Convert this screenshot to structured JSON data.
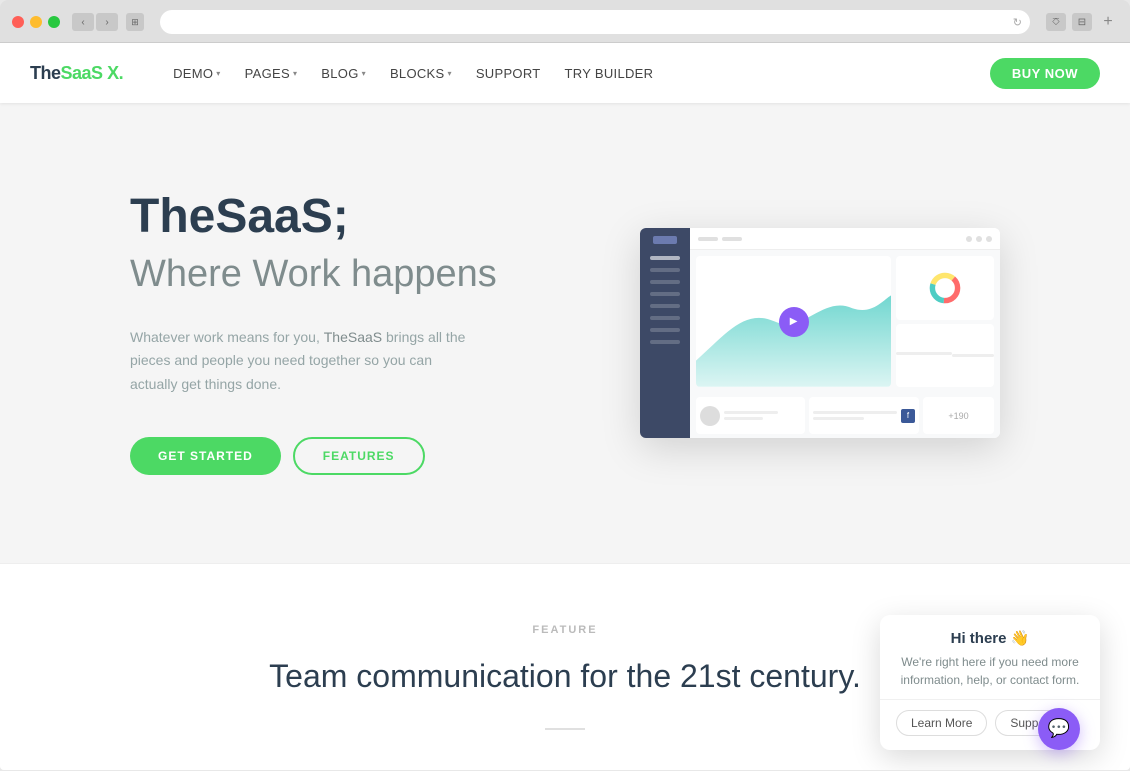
{
  "browser": {
    "traffic_lights": [
      "red",
      "yellow",
      "green"
    ],
    "back_label": "‹",
    "forward_label": "›",
    "tab_label": "⊞",
    "refresh_label": "↻",
    "share_label": "⎏",
    "new_tab_label": "+"
  },
  "navbar": {
    "brand": "TheSaaS",
    "brand_suffix": " X.",
    "nav_items": [
      {
        "label": "DEMO",
        "has_arrow": true
      },
      {
        "label": "PAGES",
        "has_arrow": true
      },
      {
        "label": "BLOG",
        "has_arrow": true
      },
      {
        "label": "BLOCKS",
        "has_arrow": true
      },
      {
        "label": "SUPPORT",
        "has_arrow": false
      },
      {
        "label": "TRY BUILDER",
        "has_arrow": false
      }
    ],
    "buy_now_label": "BUY NOW"
  },
  "hero": {
    "title_brand": "TheSaaS;",
    "title_sub": "Where Work happens",
    "description": "Whatever work means for you, TheSaaS brings all the pieces and people you need together so you can actually get things done.",
    "description_highlight": "TheSaaS",
    "btn_get_started": "GET STARTED",
    "btn_features": "FEATURES"
  },
  "bottom_section": {
    "label": "FEATURE",
    "title": "Team communication for the 21st century."
  },
  "chat_widget": {
    "greeting": "Hi there 👋",
    "message": "We're right here if you need more information, help, or contact form.",
    "btn_learn_more": "Learn More",
    "btn_support": "Support",
    "fab_icon": "💬"
  }
}
